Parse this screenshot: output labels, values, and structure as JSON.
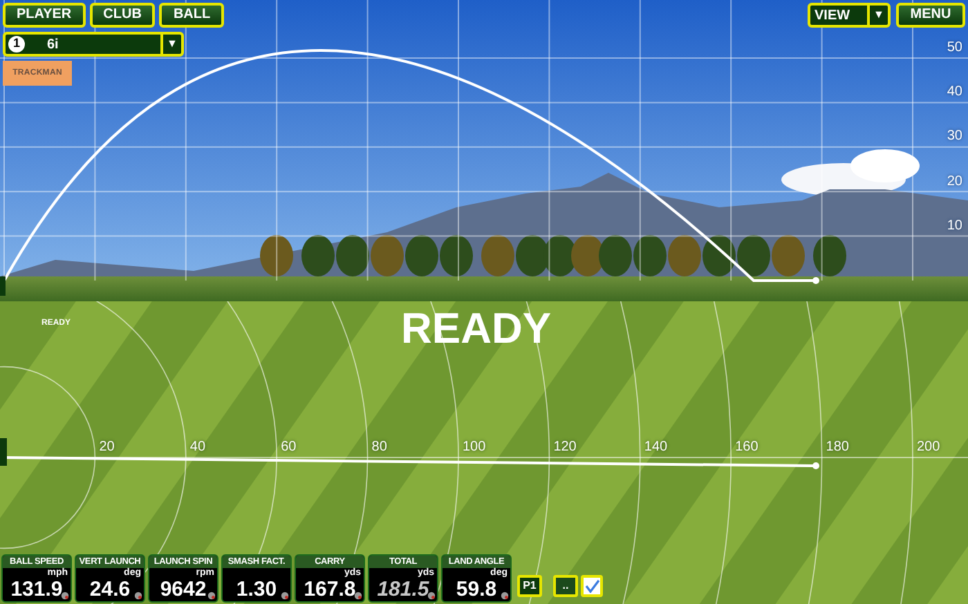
{
  "toolbar": {
    "buttons": [
      {
        "label": "PLAYER"
      },
      {
        "label": "CLUB"
      },
      {
        "label": "BALL"
      }
    ]
  },
  "club_selector": {
    "player_number": "1",
    "club": "6i",
    "dropdown": "▼"
  },
  "logo": {
    "text": "TRACKMAN"
  },
  "view_menu": {
    "label": "VIEW",
    "dropdown": "▼"
  },
  "menu_button": {
    "label": "MENU"
  },
  "side_view": {
    "height_ticks": [
      "50",
      "40",
      "30",
      "20",
      "10"
    ]
  },
  "top_view": {
    "status_small": "READY",
    "status": "READY",
    "distance_ticks": [
      "20",
      "40",
      "60",
      "80",
      "100",
      "120",
      "140",
      "160",
      "180",
      "200"
    ]
  },
  "stats": [
    {
      "label": "BALL SPEED",
      "unit": "mph",
      "value": "131.9",
      "estimated": false
    },
    {
      "label": "VERT LAUNCH",
      "unit": "deg",
      "value": "24.6",
      "estimated": false
    },
    {
      "label": "LAUNCH SPIN",
      "unit": "rpm",
      "value": "9642",
      "estimated": false
    },
    {
      "label": "SMASH FACT.",
      "value": "1.30",
      "estimated": false
    },
    {
      "label": "CARRY",
      "unit": "yds",
      "value": "167.8",
      "estimated": false
    },
    {
      "label": "TOTAL",
      "unit": "yds",
      "value": "181.5",
      "estimated": true
    },
    {
      "label": "LAND ANGLE",
      "unit": "deg",
      "value": "59.8",
      "estimated": false
    }
  ],
  "player_button": {
    "label": "P1"
  },
  "more_button": {
    "label": ".."
  },
  "confirm_checkbox": {
    "checked": true
  }
}
